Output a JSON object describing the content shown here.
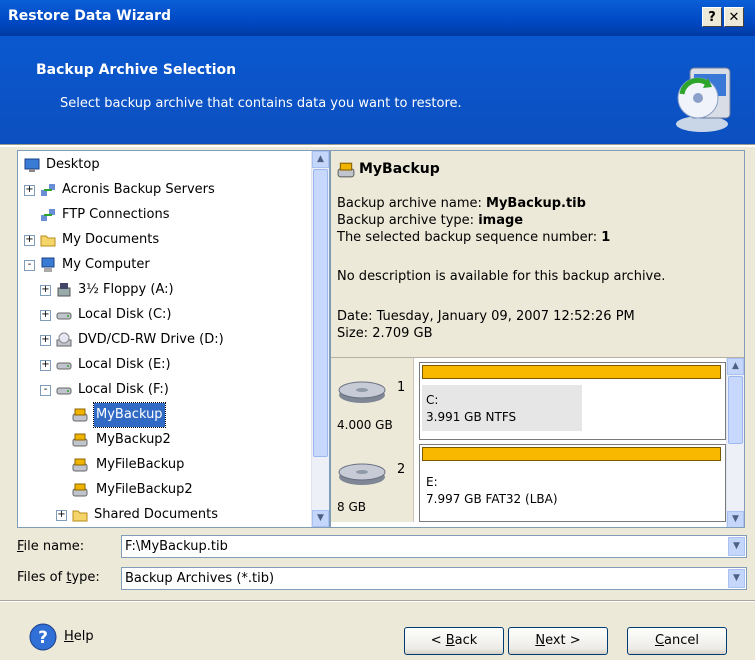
{
  "window": {
    "title": "Restore Data Wizard",
    "help_btn": "?",
    "close_btn": "✕"
  },
  "header": {
    "title": "Backup Archive Selection",
    "subtitle": "Select backup archive that contains data you want to restore."
  },
  "tree": {
    "items": [
      {
        "label": "Desktop",
        "icon": "desktop-icon",
        "expander": ""
      },
      {
        "label": "Acronis Backup Servers",
        "icon": "network-servers-icon",
        "expander": "+"
      },
      {
        "label": "FTP Connections",
        "icon": "ftp-icon",
        "expander": ""
      },
      {
        "label": "My Documents",
        "icon": "folder-icon",
        "expander": "+"
      },
      {
        "label": "My Computer",
        "icon": "computer-icon",
        "expander": "-"
      },
      {
        "label": "3½ Floppy (A:)",
        "icon": "floppy-icon",
        "expander": "+"
      },
      {
        "label": "Local Disk (C:)",
        "icon": "drive-icon",
        "expander": "+"
      },
      {
        "label": "DVD/CD-RW Drive (D:)",
        "icon": "cdrom-icon",
        "expander": "+"
      },
      {
        "label": "Local Disk (E:)",
        "icon": "drive-icon",
        "expander": "+"
      },
      {
        "label": "Local Disk (F:)",
        "icon": "drive-icon",
        "expander": "-"
      },
      {
        "label": "MyBackup",
        "icon": "backup-archive-icon",
        "expander": ""
      },
      {
        "label": "MyBackup2",
        "icon": "backup-archive-icon",
        "expander": ""
      },
      {
        "label": "MyFileBackup",
        "icon": "backup-archive-icon",
        "expander": ""
      },
      {
        "label": "MyFileBackup2",
        "icon": "backup-archive-icon",
        "expander": ""
      },
      {
        "label": "Shared Documents",
        "icon": "folder-icon",
        "expander": "+"
      }
    ]
  },
  "info": {
    "name": "MyBackup",
    "archive_name_label": "Backup archive name: ",
    "archive_name": "MyBackup.tib",
    "archive_type_label": "Backup archive type: ",
    "archive_type": "image",
    "sequence_label": "The selected backup sequence number: ",
    "sequence": "1",
    "description": "No description is available for this backup archive.",
    "date": "Date: Tuesday, January 09, 2007 12:52:26 PM",
    "size": "Size: 2.709 GB",
    "disks": [
      {
        "number": "1",
        "capacity": "4.000 GB",
        "partition_letter": "C:",
        "partition_info": "3.991 GB  NTFS"
      },
      {
        "number": "2",
        "capacity": "8 GB",
        "partition_letter": "E:",
        "partition_info": "7.997 GB  FAT32 (LBA)"
      }
    ]
  },
  "file_name": {
    "label_pre": "",
    "label_u": "F",
    "label_post": "ile name:",
    "value": "F:\\MyBackup.tib"
  },
  "file_type": {
    "label_pre": "Files of ",
    "label_u": "t",
    "label_post": "ype:",
    "value": "Backup Archives (*.tib)"
  },
  "buttons": {
    "help_u": "H",
    "help_rest": "elp",
    "back_pre": "< ",
    "back_u": "B",
    "back_rest": "ack",
    "next_u": "N",
    "next_rest": "ext >",
    "cancel_u": "C",
    "cancel_rest": "ancel"
  }
}
